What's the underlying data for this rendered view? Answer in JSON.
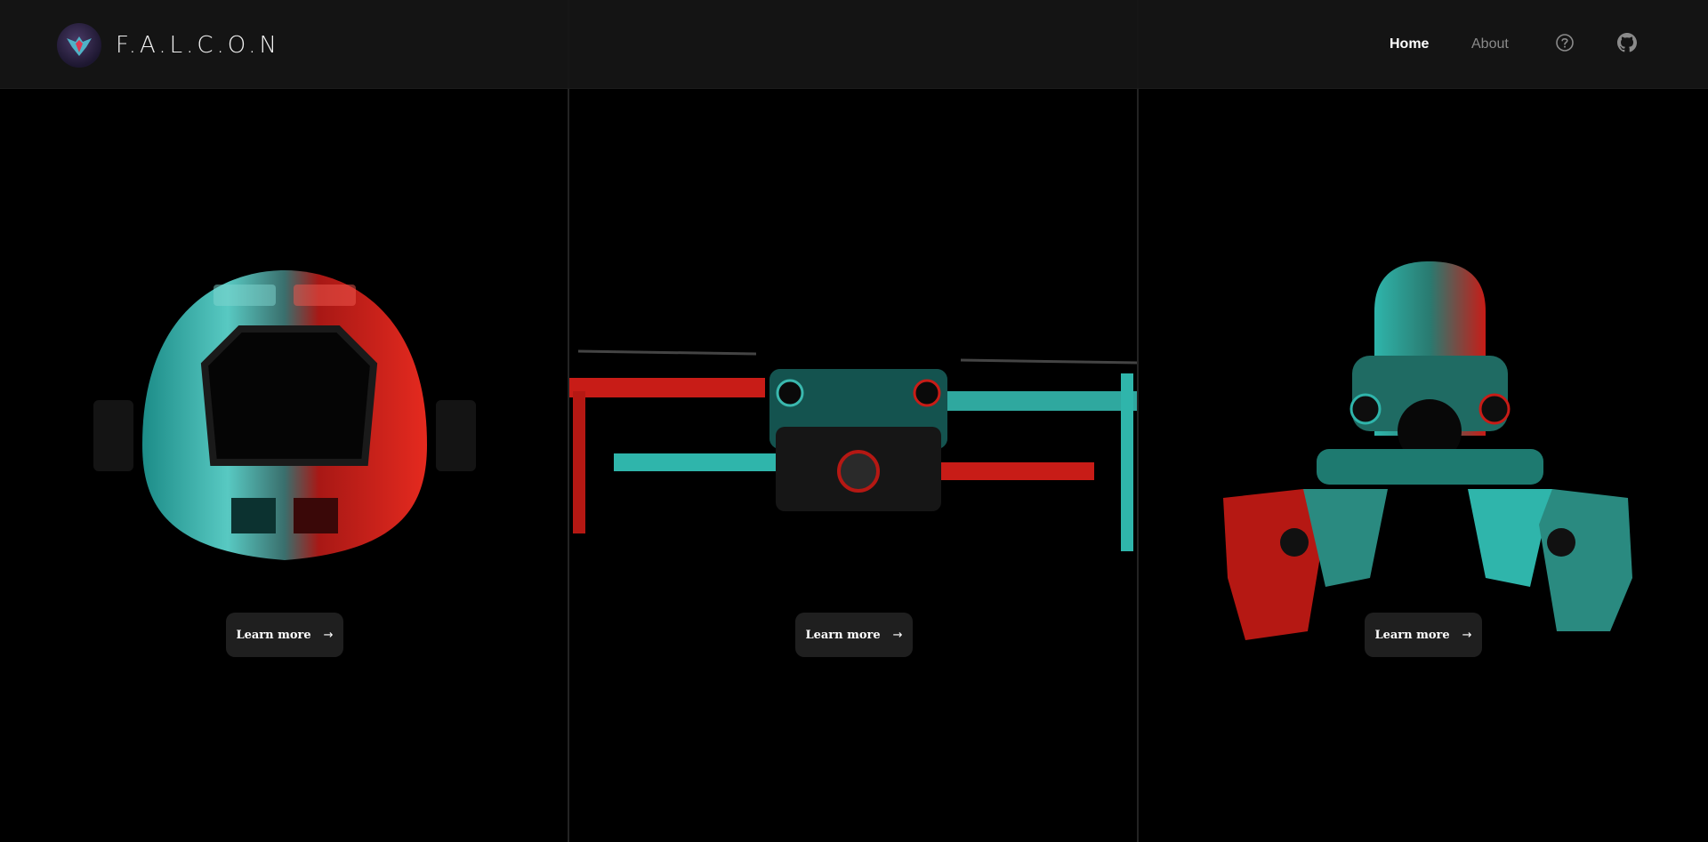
{
  "brand": {
    "name": "F.A.L.C.O.N"
  },
  "nav": {
    "home": "Home",
    "about": "About",
    "help_icon": "help-circle-icon",
    "github_icon": "github-icon"
  },
  "cards": [
    {
      "model": "round-robot-model",
      "button_label": "Learn more"
    },
    {
      "model": "quadcopter-drone-model",
      "button_label": "Learn more"
    },
    {
      "model": "spider-robot-model",
      "button_label": "Learn more"
    }
  ],
  "colors": {
    "accent_red": "#d8201a",
    "accent_teal": "#2fb5ab",
    "background": "#000000",
    "navbar": "#161616",
    "button": "#1f1f1f",
    "nav_inactive": "#8a8a8a"
  }
}
